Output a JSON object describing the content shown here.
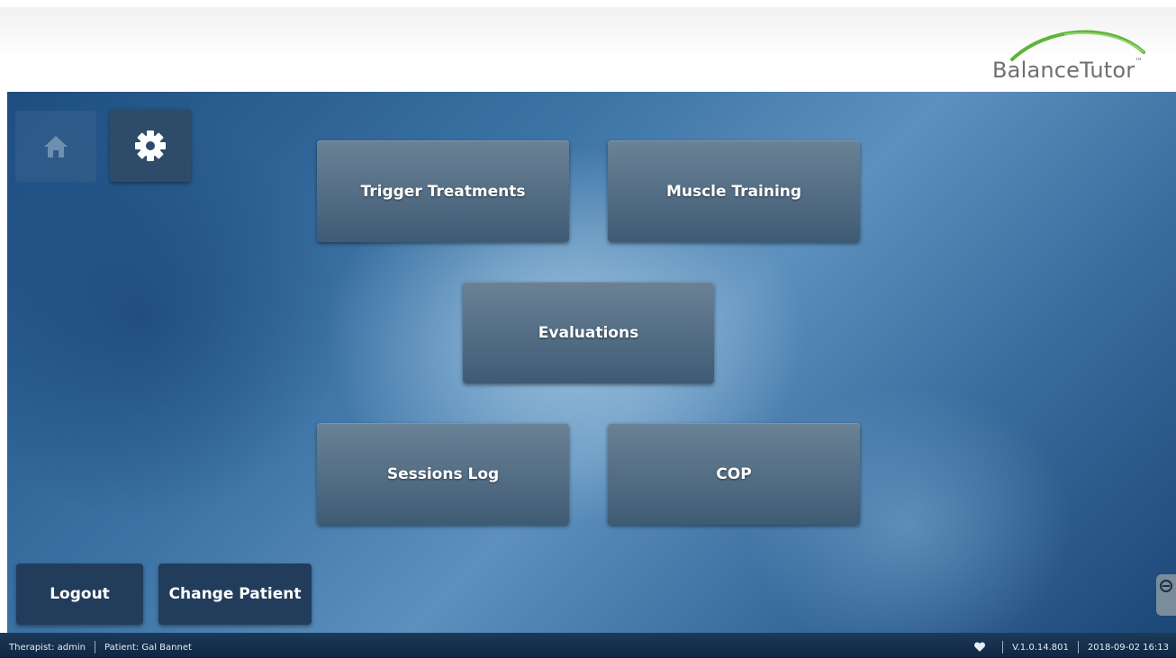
{
  "brand": {
    "name": "BalanceTutor",
    "tm": "™",
    "arc_color": "#5fb43a"
  },
  "nav": {
    "home_icon": "home-icon",
    "settings_icon": "gear-icon"
  },
  "menu": {
    "trigger_treatments": "Trigger Treatments",
    "muscle_training": "Muscle Training",
    "evaluations": "Evaluations",
    "sessions_log": "Sessions Log",
    "cop": "COP"
  },
  "actions": {
    "logout": "Logout",
    "change_patient": "Change Patient"
  },
  "status": {
    "therapist": "Therapist: admin",
    "patient": "Patient: Gal Bannet",
    "heart_icon": "heart-icon",
    "version": "V.1.0.14.801",
    "datetime": "2018-09-02 16:13"
  },
  "colors": {
    "tile": "#4f6b84",
    "statusbar": "#14304e",
    "accent_green": "#5fb43a"
  }
}
